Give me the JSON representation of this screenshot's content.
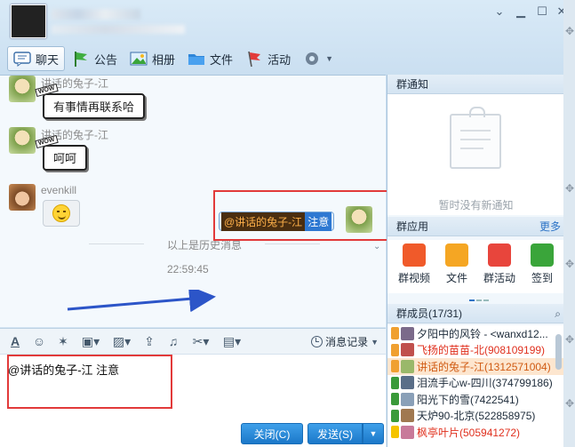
{
  "window": {
    "title": "",
    "controls": [
      "minimize",
      "maximize",
      "close"
    ]
  },
  "toolbar": [
    {
      "label": "聊天",
      "icon": "chat-icon",
      "active": true
    },
    {
      "label": "公告",
      "icon": "flag-icon"
    },
    {
      "label": "相册",
      "icon": "photo-icon"
    },
    {
      "label": "文件",
      "icon": "folder-icon"
    },
    {
      "label": "活动",
      "icon": "activity-flag-icon"
    },
    {
      "label": "",
      "icon": "gear-icon"
    }
  ],
  "messages": [
    {
      "sender": "讲话的兔子-江",
      "text": "有事情再联系哈",
      "tag": "WOW"
    },
    {
      "sender": "讲话的兔子-江",
      "text": "呵呵",
      "tag": "WOW"
    },
    {
      "sender": "evenkill",
      "emoji": "smiley"
    }
  ],
  "history_divider": "以上是历史消息",
  "sent_time": "22:59:45",
  "sent_message": {
    "mention": "@讲话的兔子-江",
    "text": "注意"
  },
  "input_toolbar": {
    "message_record": "消息记录"
  },
  "input": {
    "text": "@讲话的兔子-江 注意"
  },
  "buttons": {
    "close": "关闭(C)",
    "send": "发送(S)"
  },
  "notice": {
    "title": "群通知",
    "empty": "暂时没有新通知"
  },
  "apps": {
    "title": "群应用",
    "more": "更多",
    "items": [
      {
        "label": "群视频",
        "color": "#f05a2a"
      },
      {
        "label": "文件",
        "color": "#f5a623"
      },
      {
        "label": "群活动",
        "color": "#e8453c"
      },
      {
        "label": "签到",
        "color": "#3aa53a"
      }
    ]
  },
  "members": {
    "title": "群成员(17/31)",
    "list": [
      {
        "name": "夕阳中的风铃 - <wanxd12...",
        "color": "black"
      },
      {
        "name": "飞扬的苗苗-北(908109199)",
        "color": "red"
      },
      {
        "name": "讲话的兔子-江(1312571004)",
        "color": "orange",
        "highlight": true
      },
      {
        "name": "泪流手心w-四川(374799186)",
        "color": "black"
      },
      {
        "name": "阳光下的雪(7422541)",
        "color": "black"
      },
      {
        "name": "天炉90-北京(522858975)",
        "color": "black"
      },
      {
        "name": "枫亭叶片(505941272)",
        "color": "red"
      }
    ]
  }
}
